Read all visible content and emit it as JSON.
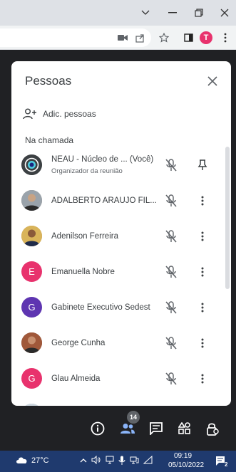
{
  "panel": {
    "title": "Pessoas",
    "add_people_label": "Adic. pessoas",
    "section_label": "Na chamada"
  },
  "participants": [
    {
      "name": "NEAU - Núcleo de ... (Você)",
      "subtitle": "Organizador da reunião",
      "avatar_type": "icon",
      "avatar_color": "#3c4043"
    },
    {
      "name": "ADALBERTO ARAUJO FIL...",
      "avatar_type": "photo",
      "avatar_color": "#8a7a6a"
    },
    {
      "name": "Adenilson Ferreira",
      "avatar_type": "photo",
      "avatar_color": "#b08a5a"
    },
    {
      "name": "Emanuella Nobre",
      "avatar_type": "letter",
      "letter": "E",
      "avatar_color": "#e8326d"
    },
    {
      "name": "Gabinete Executivo Sedest",
      "avatar_type": "letter",
      "letter": "G",
      "avatar_color": "#5e35b1"
    },
    {
      "name": "George Cunha",
      "avatar_type": "photo",
      "avatar_color": "#7a4a3a"
    },
    {
      "name": "Glau Almeida",
      "avatar_type": "letter",
      "letter": "G",
      "avatar_color": "#e8326d"
    },
    {
      "name": "",
      "avatar_type": "photo",
      "avatar_color": "#8aa0b8"
    }
  ],
  "people_count": "14",
  "browser": {
    "profile_letter": "T",
    "profile_color": "#e8326d"
  },
  "taskbar": {
    "temperature": "27°C",
    "time": "09:19",
    "date": "05/10/2022",
    "notification_count": "2"
  }
}
